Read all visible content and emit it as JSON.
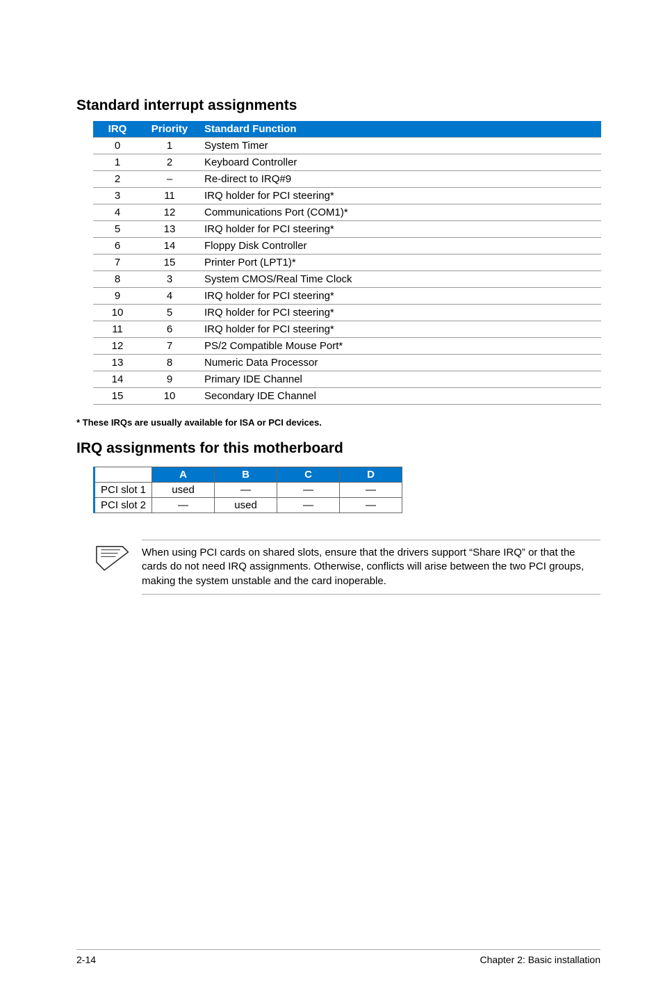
{
  "section1_title": "Standard interrupt assignments",
  "irq_headers": {
    "c1": "IRQ",
    "c2": "Priority",
    "c3": "Standard Function"
  },
  "irq_rows": [
    {
      "irq": "0",
      "pri": "1",
      "fn": "System Timer"
    },
    {
      "irq": "1",
      "pri": "2",
      "fn": "Keyboard Controller"
    },
    {
      "irq": "2",
      "pri": "–",
      "fn": "Re-direct to IRQ#9"
    },
    {
      "irq": "3",
      "pri": "11",
      "fn": "IRQ holder for PCI steering*"
    },
    {
      "irq": "4",
      "pri": "12",
      "fn": "Communications Port (COM1)*"
    },
    {
      "irq": "5",
      "pri": "13",
      "fn": "IRQ holder for PCI steering*"
    },
    {
      "irq": "6",
      "pri": "14",
      "fn": "Floppy Disk Controller"
    },
    {
      "irq": "7",
      "pri": "15",
      "fn": "Printer Port (LPT1)*"
    },
    {
      "irq": "8",
      "pri": "3",
      "fn": "System CMOS/Real Time Clock"
    },
    {
      "irq": "9",
      "pri": "4",
      "fn": "IRQ holder for PCI steering*"
    },
    {
      "irq": "10",
      "pri": "5",
      "fn": "IRQ holder for PCI steering*"
    },
    {
      "irq": "11",
      "pri": "6",
      "fn": "IRQ holder for PCI steering*"
    },
    {
      "irq": "12",
      "pri": "7",
      "fn": "PS/2 Compatible Mouse Port*"
    },
    {
      "irq": "13",
      "pri": "8",
      "fn": "Numeric Data Processor"
    },
    {
      "irq": "14",
      "pri": "9",
      "fn": "Primary IDE Channel"
    },
    {
      "irq": "15",
      "pri": "10",
      "fn": "Secondary IDE Channel"
    }
  ],
  "footnote": "* These IRQs are usually available for ISA or PCI devices.",
  "section2_title": "IRQ assignments for this motherboard",
  "pci_headers": {
    "a": "A",
    "b": "B",
    "c": "C",
    "d": "D"
  },
  "pci_rows": [
    {
      "name": "PCI slot 1",
      "a": "used",
      "b": "—",
      "c": "—",
      "d": "—"
    },
    {
      "name": "PCI slot 2",
      "a": "—",
      "b": "used",
      "c": "—",
      "d": "—"
    }
  ],
  "note_text": "When using PCI cards on shared slots, ensure that the drivers support “Share IRQ” or that the cards do not need IRQ assignments. Otherwise, conflicts will arise between the two PCI groups, making the system unstable and the card inoperable.",
  "footer_left": "2-14",
  "footer_right": "Chapter 2: Basic installation"
}
